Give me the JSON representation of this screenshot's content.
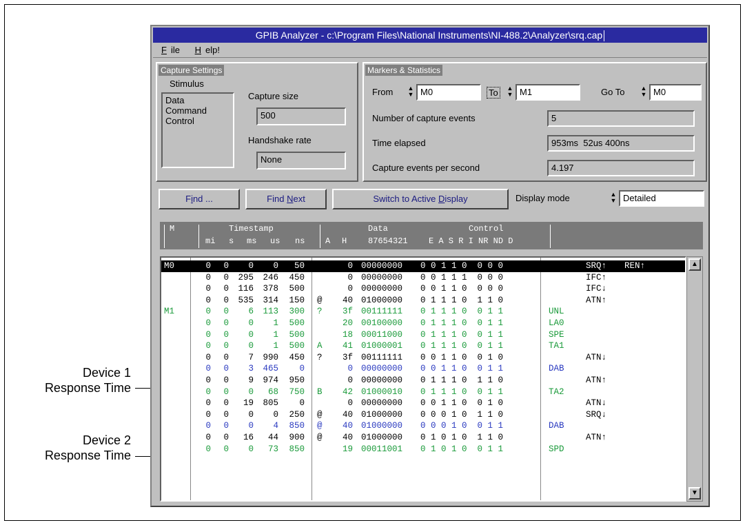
{
  "annotations": {
    "device1": [
      "Device 1",
      "Response Time"
    ],
    "device2": [
      "Device 2",
      "Response Time"
    ]
  },
  "window": {
    "title": "GPIB Analyzer - c:\\Program Files\\National Instruments\\NI-488.2\\Analyzer\\srq.cap",
    "menu": {
      "file": "File",
      "help": "Help!"
    }
  },
  "capture_settings": {
    "title": "Capture Settings",
    "stimulus_label": "Stimulus",
    "stimulus_items": [
      "Data",
      "Command",
      "Control"
    ],
    "capture_size_label": "Capture size",
    "capture_size": "500",
    "handshake_rate_label": "Handshake rate",
    "handshake_rate": "None"
  },
  "markers": {
    "title": "Markers & Statistics",
    "from_label": "From",
    "from_value": "M0",
    "to_label": "To",
    "to_value": "M1",
    "goto_label": "Go To",
    "goto_value": "M0",
    "events_label": "Number of capture events",
    "events_value": "5",
    "elapsed_label": "Time elapsed",
    "elapsed_value": "953ms  52us 400ns",
    "rate_label": "Capture events per second",
    "rate_value": "4.197"
  },
  "toolbar": {
    "find": "Find ...",
    "find_next": "Find Next",
    "switch": "Switch to Active Display",
    "display_mode_label": "Display mode",
    "display_mode_value": "Detailed"
  },
  "columns": {
    "m": "M",
    "timestamp": "Timestamp",
    "ts_units": [
      "mi",
      "s",
      "ms",
      "us",
      "ns"
    ],
    "data": "Data",
    "a": "A",
    "h": "H",
    "bits": "87654321",
    "control": "Control",
    "control_flags": "E A S R I NR ND D"
  },
  "colors": {
    "green": "#1a9a3a",
    "blue": "#2a3ac0",
    "black": "#000000"
  },
  "rows": [
    {
      "m": "M0",
      "mi": "0",
      "s": "0",
      "ms": "0",
      "us": "0",
      "ns": "50",
      "a": "",
      "h": "0",
      "bits": "00000000",
      "ctl": "0 0 1 1 0  0 0 0",
      "cmd": "",
      "line": "SRQ↑",
      "extra": "REN↑",
      "style": "selected"
    },
    {
      "m": "",
      "mi": "0",
      "s": "0",
      "ms": "295",
      "us": "246",
      "ns": "450",
      "a": "",
      "h": "0",
      "bits": "00000000",
      "ctl": "0 0 1 1 1  0 0 0",
      "cmd": "",
      "line": "IFC↑",
      "extra": "",
      "style": "black"
    },
    {
      "m": "",
      "mi": "0",
      "s": "0",
      "ms": "116",
      "us": "378",
      "ns": "500",
      "a": "",
      "h": "0",
      "bits": "00000000",
      "ctl": "0 0 1 1 0  0 0 0",
      "cmd": "",
      "line": "IFC↓",
      "extra": "",
      "style": "black"
    },
    {
      "m": "",
      "mi": "0",
      "s": "0",
      "ms": "535",
      "us": "314",
      "ns": "150",
      "a": "@",
      "h": "40",
      "bits": "01000000",
      "ctl": "0 1 1 1 0  1 1 0",
      "cmd": "",
      "line": "ATN↑",
      "extra": "",
      "style": "black"
    },
    {
      "m": "M1",
      "mi": "0",
      "s": "0",
      "ms": "6",
      "us": "113",
      "ns": "300",
      "a": "?",
      "h": "3f",
      "bits": "00111111",
      "ctl": "0 1 1 1 0  0 1 1",
      "cmd": "UNL",
      "line": "",
      "extra": "",
      "style": "green"
    },
    {
      "m": "",
      "mi": "0",
      "s": "0",
      "ms": "0",
      "us": "1",
      "ns": "500",
      "a": "",
      "h": "20",
      "bits": "00100000",
      "ctl": "0 1 1 1 0  0 1 1",
      "cmd": "LA0",
      "line": "",
      "extra": "",
      "style": "green"
    },
    {
      "m": "",
      "mi": "0",
      "s": "0",
      "ms": "0",
      "us": "1",
      "ns": "500",
      "a": "",
      "h": "18",
      "bits": "00011000",
      "ctl": "0 1 1 1 0  0 1 1",
      "cmd": "SPE",
      "line": "",
      "extra": "",
      "style": "green"
    },
    {
      "m": "",
      "mi": "0",
      "s": "0",
      "ms": "0",
      "us": "1",
      "ns": "500",
      "a": "A",
      "h": "41",
      "bits": "01000001",
      "ctl": "0 1 1 1 0  0 1 1",
      "cmd": "TA1",
      "line": "",
      "extra": "",
      "style": "green"
    },
    {
      "m": "",
      "mi": "0",
      "s": "0",
      "ms": "7",
      "us": "990",
      "ns": "450",
      "a": "?",
      "h": "3f",
      "bits": "00111111",
      "ctl": "0 0 1 1 0  0 1 0",
      "cmd": "",
      "line": "ATN↓",
      "extra": "",
      "style": "black"
    },
    {
      "m": "",
      "mi": "0",
      "s": "0",
      "ms": "3",
      "us": "465",
      "ns": "0",
      "a": "",
      "h": "0",
      "bits": "00000000",
      "ctl": "0 0 1 1 0  0 1 1",
      "cmd": "DAB",
      "line": "",
      "extra": "",
      "style": "blue"
    },
    {
      "m": "",
      "mi": "0",
      "s": "0",
      "ms": "9",
      "us": "974",
      "ns": "950",
      "a": "",
      "h": "0",
      "bits": "00000000",
      "ctl": "0 1 1 1 0  1 1 0",
      "cmd": "",
      "line": "ATN↑",
      "extra": "",
      "style": "black"
    },
    {
      "m": "",
      "mi": "0",
      "s": "0",
      "ms": "0",
      "us": "68",
      "ns": "750",
      "a": "B",
      "h": "42",
      "bits": "01000010",
      "ctl": "0 1 1 1 0  0 1 1",
      "cmd": "TA2",
      "line": "",
      "extra": "",
      "style": "green"
    },
    {
      "m": "",
      "mi": "0",
      "s": "0",
      "ms": "19",
      "us": "805",
      "ns": "0",
      "a": "",
      "h": "0",
      "bits": "00000000",
      "ctl": "0 0 1 1 0  0 1 0",
      "cmd": "",
      "line": "ATN↓",
      "extra": "",
      "style": "black"
    },
    {
      "m": "",
      "mi": "0",
      "s": "0",
      "ms": "0",
      "us": "0",
      "ns": "250",
      "a": "@",
      "h": "40",
      "bits": "01000000",
      "ctl": "0 0 0 1 0  1 1 0",
      "cmd": "",
      "line": "SRQ↓",
      "extra": "",
      "style": "black"
    },
    {
      "m": "",
      "mi": "0",
      "s": "0",
      "ms": "0",
      "us": "4",
      "ns": "850",
      "a": "@",
      "h": "40",
      "bits": "01000000",
      "ctl": "0 0 0 1 0  0 1 1",
      "cmd": "DAB",
      "line": "",
      "extra": "",
      "style": "blue"
    },
    {
      "m": "",
      "mi": "0",
      "s": "0",
      "ms": "16",
      "us": "44",
      "ns": "900",
      "a": "@",
      "h": "40",
      "bits": "01000000",
      "ctl": "0 1 0 1 0  1 1 0",
      "cmd": "",
      "line": "ATN↑",
      "extra": "",
      "style": "black"
    },
    {
      "m": "",
      "mi": "0",
      "s": "0",
      "ms": "0",
      "us": "73",
      "ns": "850",
      "a": "",
      "h": "19",
      "bits": "00011001",
      "ctl": "0 1 0 1 0  0 1 1",
      "cmd": "SPD",
      "line": "",
      "extra": "",
      "style": "green"
    }
  ],
  "scrollbar": {
    "up_icon": "arrow-up-icon",
    "down_icon": "arrow-down-icon"
  }
}
